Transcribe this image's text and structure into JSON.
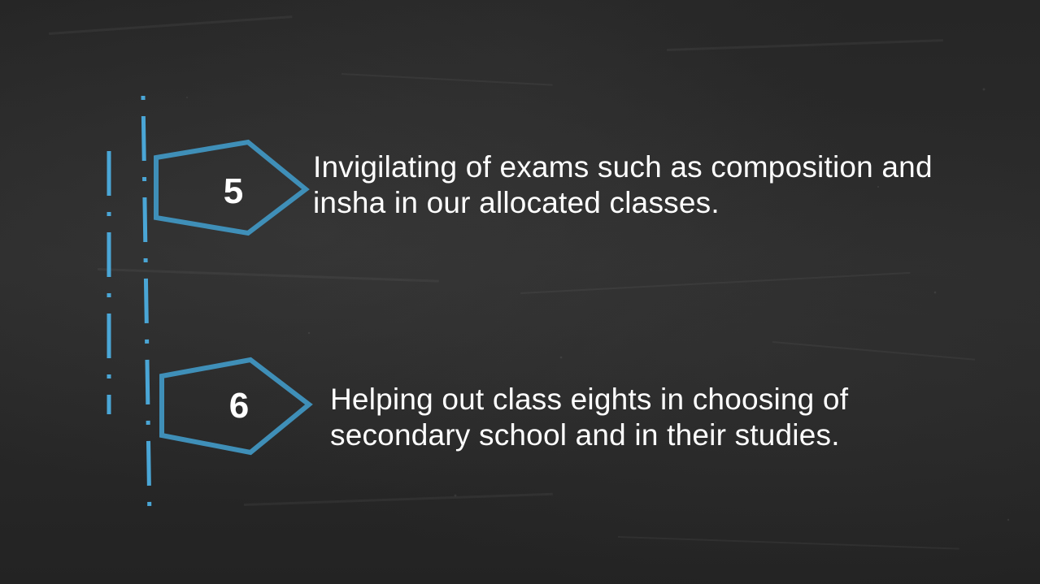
{
  "slide": {
    "background_color": "#262626",
    "accent_color": "#3f8fb8",
    "dash_color": "#4aa6d6",
    "text_color": "#ffffff"
  },
  "steps": [
    {
      "number": "5",
      "lines": [
        "Invigilating of exams such as composition and",
        "insha in our allocated classes."
      ]
    },
    {
      "number": "6",
      "lines": [
        "Helping out class eights in choosing of",
        "secondary school and in their studies."
      ]
    }
  ]
}
